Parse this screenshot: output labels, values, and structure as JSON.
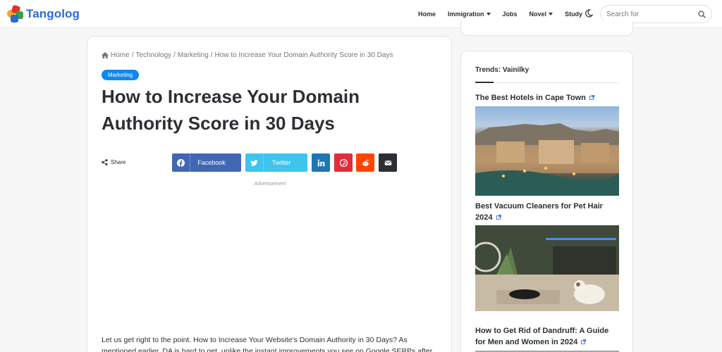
{
  "site": {
    "logo_text": "Tangolog"
  },
  "nav": {
    "items": [
      {
        "label": "Home"
      },
      {
        "label": "Immigration"
      },
      {
        "label": "Jobs"
      },
      {
        "label": "Novel"
      },
      {
        "label": "Study"
      }
    ]
  },
  "search": {
    "placeholder": "Search for"
  },
  "breadcrumb": {
    "home": "Home",
    "items": [
      "Technology",
      "Marketing",
      "How to Increase Your Domain Authority Score in 30 Days"
    ],
    "separator": "/"
  },
  "article": {
    "category": "Marketing",
    "title": "How to Increase Your Domain Authority Score in 30 Days",
    "share_label": "Share",
    "share_buttons": {
      "facebook": "Facebook",
      "twitter": "Twitter"
    },
    "ad_label": "Advertisement",
    "body": "Let us get right to the point. How to Increase Your Website's Domain Authority in 30 Days? As mentioned earlier, DA is hard to get, unlike the instant improvements you see on Google SERPs after"
  },
  "sidebar": {
    "title": "Trends: Vainilky",
    "posts": [
      {
        "title": "The Best Hotels in Cape Town"
      },
      {
        "title": "Best Vacuum Cleaners for Pet Hair 2024"
      },
      {
        "title": "How to Get Rid of Dandruff: A Guide for Men and Women in 2024"
      }
    ]
  },
  "colors": {
    "brand": "#2b6bd6",
    "category_badge": "#0d88f2",
    "facebook": "#4267b2",
    "twitter": "#3ec4ed",
    "linkedin": "#1f76b4",
    "pinterest": "#e12c3b",
    "reddit": "#ff4500",
    "email": "#2c2f34"
  }
}
